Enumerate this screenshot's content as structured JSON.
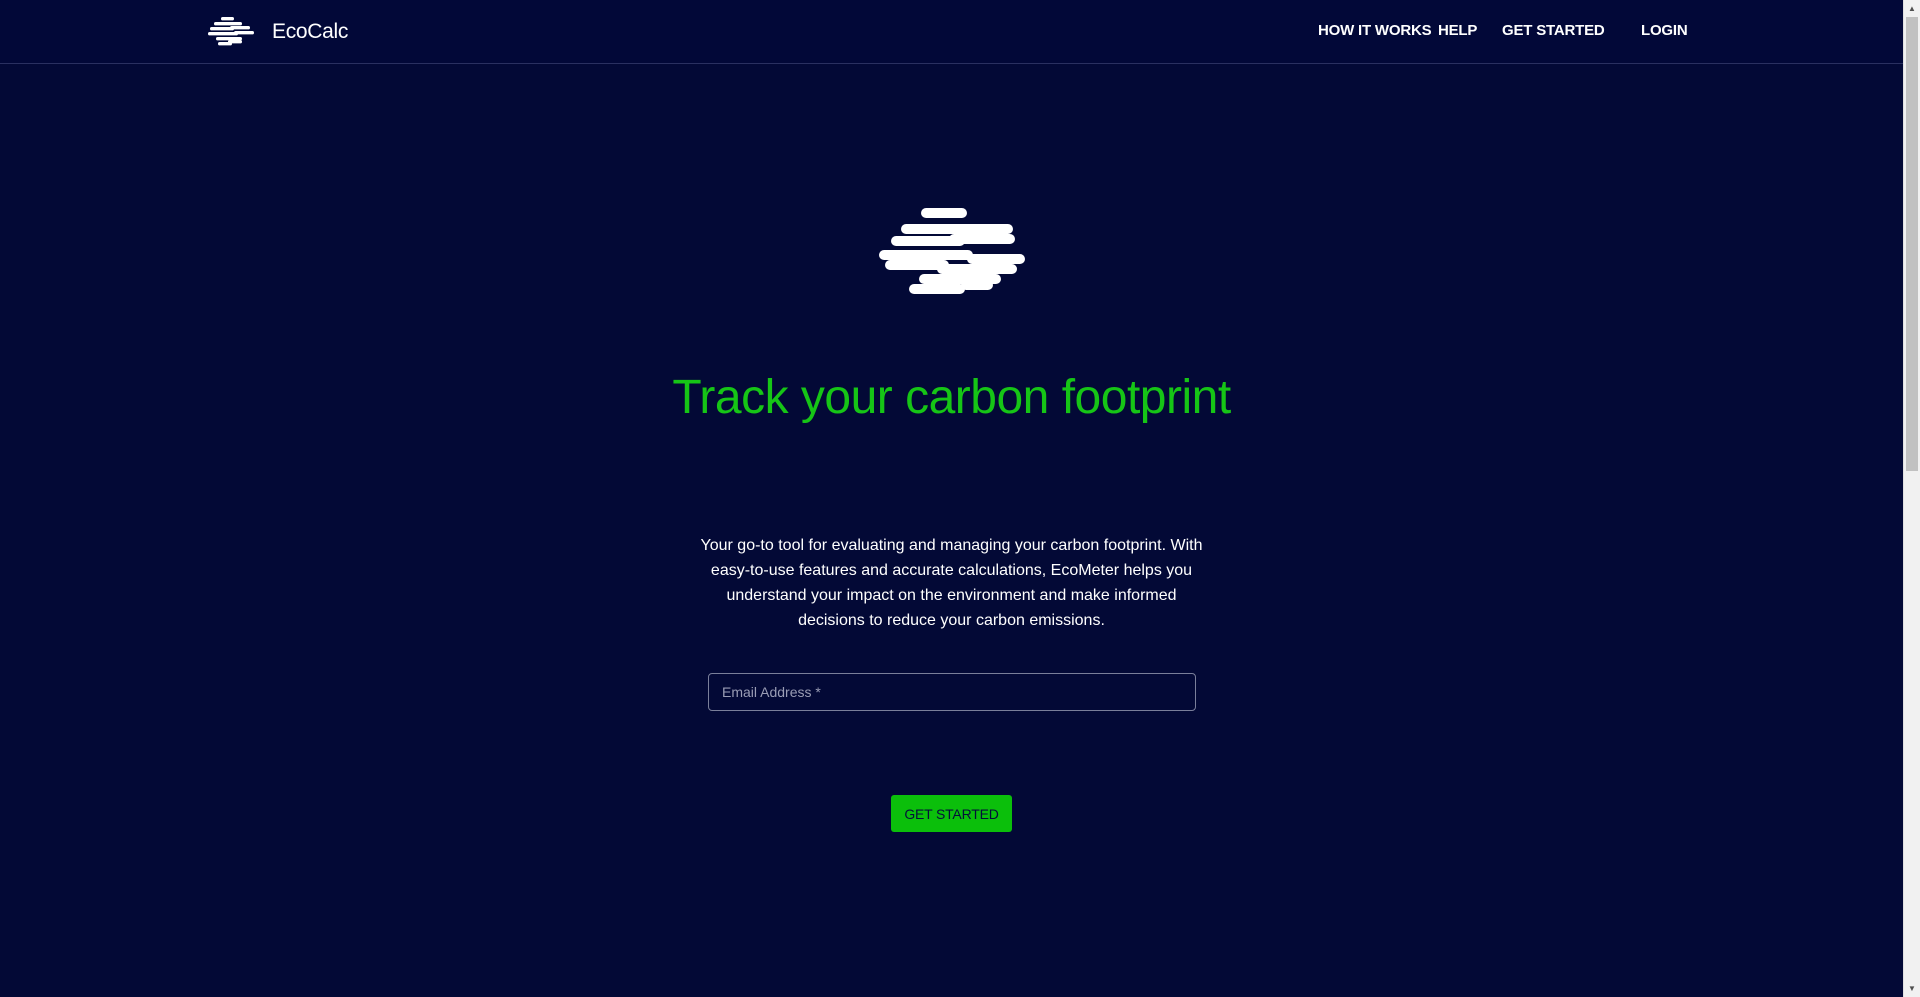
{
  "brand": {
    "name": "EcoCalc",
    "logo_icon": "wind-stripes-logo-icon"
  },
  "nav": {
    "how_it_works": "HOW IT WORKS",
    "help": "HELP",
    "get_started": "GET STARTED",
    "login": "LOGIN"
  },
  "hero": {
    "logo_icon": "wind-stripes-logo-icon",
    "title": "Track your carbon footprint",
    "description": "Your go-to tool for evaluating and managing your carbon footprint. With easy-to-use features and accurate calculations, EcoMeter helps you understand your impact on the environment and make informed decisions to reduce your carbon emissions.",
    "email_placeholder": "Email Address *",
    "email_value": "",
    "cta_label": "GET STARTED"
  },
  "colors": {
    "background": "#030936",
    "accent_green": "#16c516",
    "button_green": "#0bbf0b",
    "text": "#ffffff"
  }
}
